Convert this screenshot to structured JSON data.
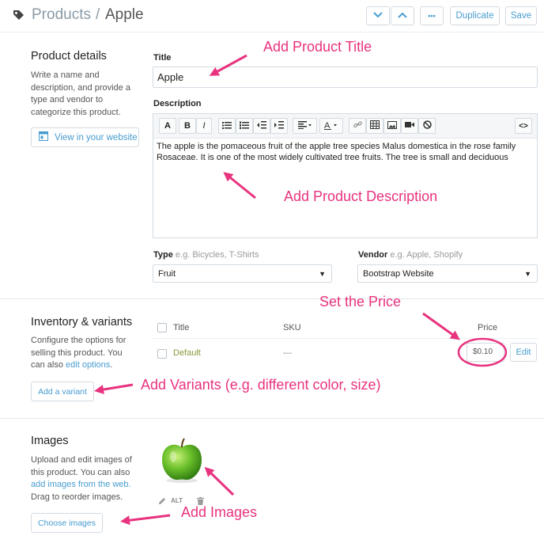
{
  "header": {
    "breadcrumb_parent": "Products",
    "breadcrumb_sep": "/",
    "breadcrumb_current": "Apple",
    "duplicate_label": "Duplicate",
    "save_label": "Save",
    "more_label": "•••"
  },
  "product_details": {
    "title": "Product details",
    "description": "Write a name and description, and provide a type and vendor to categorize this product.",
    "view_website_label": "View in your website",
    "title_label": "Title",
    "title_value": "Apple",
    "description_label": "Description",
    "description_value": "The apple is the pomaceous fruit of the apple tree species Malus domestica in the rose family Rosaceae. It is one of the most widely cultivated tree fruits. The tree is small and deciduous",
    "type_label": "Type",
    "type_hint": "e.g. Bicycles, T-Shirts",
    "type_value": "Fruit",
    "vendor_label": "Vendor",
    "vendor_hint": "e.g. Apple, Shopify",
    "vendor_value": "Bootstrap Website"
  },
  "editor_toolbar": {
    "bold": "B",
    "italic": "I",
    "code": "<>"
  },
  "inventory": {
    "title": "Inventory & variants",
    "description_part1": "Configure the options for selling this product. You can also ",
    "edit_options_link": "edit options",
    "description_part2": ".",
    "add_variant_label": "Add a variant",
    "columns": {
      "title": "Title",
      "sku": "SKU",
      "price": "Price"
    },
    "row": {
      "title": "Default",
      "sku": "—",
      "price": "$0.10",
      "edit_label": "Edit"
    }
  },
  "images": {
    "title": "Images",
    "description_part1": "Upload and edit images of this product. You can also ",
    "web_link": "add images from the web.",
    "description_part2": " Drag to reorder images.",
    "alt_label": "ALT",
    "choose_label": "Choose images"
  },
  "annotations": {
    "title": "Add Product Title",
    "description": "Add Product Description",
    "price": "Set the Price",
    "variants": "Add Variants (e.g. different color, size)",
    "images": "Add Images"
  },
  "colors": {
    "accent": "#479ccf",
    "annotation": "#e8337f",
    "variant_text": "#8a9a3a",
    "apple_green": "#6abf2a"
  }
}
